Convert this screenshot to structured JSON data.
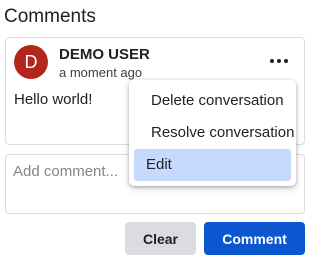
{
  "panel": {
    "title": "Comments"
  },
  "comment": {
    "avatar_initial": "D",
    "author": "DEMO USER",
    "timestamp": "a moment ago",
    "text": "Hello world!"
  },
  "menu": {
    "items": [
      {
        "label": "Delete conversation"
      },
      {
        "label": "Resolve conversation"
      },
      {
        "label": "Edit",
        "selected": true
      }
    ]
  },
  "composer": {
    "placeholder": "Add comment...",
    "value": ""
  },
  "actions": {
    "clear_label": "Clear",
    "comment_label": "Comment"
  },
  "colors": {
    "avatar": "#b3261e",
    "primary": "#0b57d0",
    "secondary_button": "#dadce0",
    "menu_highlight": "#c6dafc"
  },
  "icons": {
    "more": "more-horizontal-icon"
  }
}
